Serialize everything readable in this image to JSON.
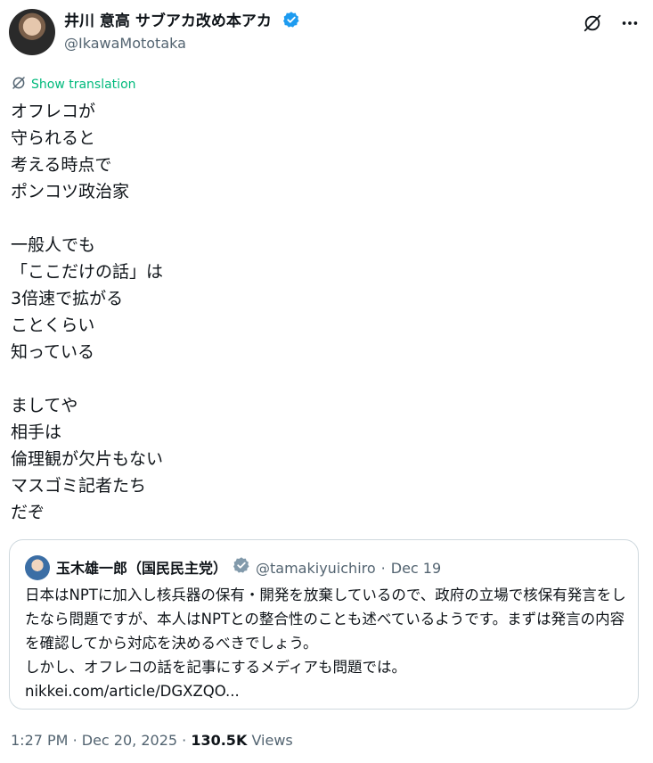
{
  "author": {
    "name": "井川 意高 サブアカ改め本アカ",
    "handle": "@IkawaMototaka"
  },
  "show_translation": "Show translation",
  "tweet_text": "オフレコが\n守られると\n考える時点で\nポンコツ政治家\n\n一般人でも\n「ここだけの話」は\n3倍速で拡がる\nことくらい\n知っている\n\nましてや\n相手は\n倫理観が欠片もない\nマスゴミ記者たち\nだぞ",
  "quote": {
    "name": "玉木雄一郎（国民民主党）",
    "handle": "@tamakiyuichiro",
    "separator": "·",
    "date": "Dec 19",
    "text": "日本はNPTに加入し核兵器の保有・開発を放棄しているので、政府の立場で核保有発言をしたなら問題ですが、本人はNPTとの整合性のことも述べているようです。まずは発言の内容を確認してから対応を決めるべきでしょう。\nしかし、オフレコの話を記事にするメディアも問題では。",
    "link": "nikkei.com/article/DGXZQO..."
  },
  "footer": {
    "time": "1:27 PM",
    "separator": "·",
    "date": "Dec 20, 2025",
    "separator2": "·",
    "views_count": "130.5K",
    "views_label": "Views"
  },
  "colors": {
    "verified_blue": "#1d9bf0",
    "verified_gray": "#829aab",
    "translation_green": "#00ba7c",
    "muted_text": "#536471"
  },
  "icons": [
    "avatar",
    "verified-badge-icon",
    "grok-icon",
    "more-icon",
    "translate-icon"
  ]
}
